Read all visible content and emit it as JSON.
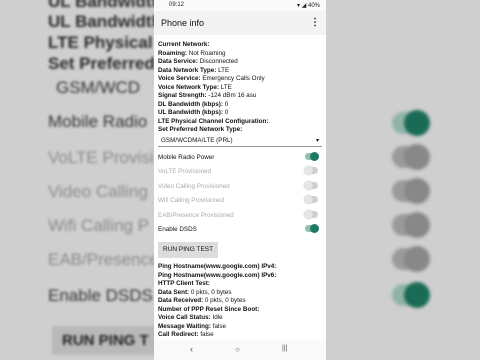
{
  "status_bar": {
    "time": "09:12",
    "battery": "40%"
  },
  "app": {
    "title": "Phone info",
    "menu_icon": "⋮"
  },
  "rows_top": [
    {
      "label": "Current Network:",
      "value": ""
    },
    {
      "label": "Roaming:",
      "value": "Not Roaming"
    },
    {
      "label": "Data Service:",
      "value": "Disconnected"
    },
    {
      "label": "Data Network Type:",
      "value": "LTE"
    },
    {
      "label": "Voice Service:",
      "value": "Emergency Calls Only"
    },
    {
      "label": "Voice Network Type:",
      "value": "LTE"
    },
    {
      "label": "Signal Strength:",
      "value": "-124 dBm   16 asu"
    },
    {
      "label": "DL Bandwidth (kbps):",
      "value": "0"
    },
    {
      "label": "UL Bandwidth (kbps):",
      "value": "0"
    },
    {
      "label": "LTE Physical Channel Configuration:",
      "value": ""
    }
  ],
  "preferred_network": {
    "label": "Set Preferred Network Type:",
    "value": "GSM/WCDMA/LTE (PRL)"
  },
  "switches": [
    {
      "label": "Mobile Radio Power",
      "on": true,
      "disabled": false
    },
    {
      "label": "VoLTE Provisioned",
      "on": false,
      "disabled": true
    },
    {
      "label": "Video Calling Provisioned",
      "on": false,
      "disabled": true
    },
    {
      "label": "Wifi Calling Provisioned",
      "on": false,
      "disabled": true
    },
    {
      "label": "EAB/Presence Provisioned",
      "on": false,
      "disabled": true
    },
    {
      "label": "Enable DSDS",
      "on": true,
      "disabled": false
    }
  ],
  "ping_button": "RUN PING TEST",
  "rows_bottom": [
    {
      "label": "Ping Hostname(www.google.com) IPv4:",
      "value": ""
    },
    {
      "label": "Ping Hostname(www.google.com) IPv6:",
      "value": ""
    },
    {
      "label": "HTTP Client Test:",
      "value": ""
    },
    {
      "label": "Data Sent:",
      "value": "0 pkts, 0 bytes"
    },
    {
      "label": "Data Received:",
      "value": "0 pkts, 0 bytes"
    },
    {
      "label": "Number of PPP Reset Since Boot:",
      "value": ""
    },
    {
      "label": "Voice Call Status:",
      "value": "Idle"
    },
    {
      "label": "Message Waiting:",
      "value": "false"
    },
    {
      "label": "Call Redirect:",
      "value": "false"
    }
  ],
  "background": {
    "lines": [
      "UL Bandwidth",
      "LTE Physical C",
      "Set Preferred",
      "GSM/WCD",
      "Mobile Radio",
      "VoLTE Provisi",
      "Video Calling",
      "Wifi Calling P",
      "EAB/Presence",
      "Enable DSDS",
      "RUN PING T"
    ]
  },
  "nav": {
    "back": "‹",
    "home": "○",
    "recents": "|||"
  }
}
